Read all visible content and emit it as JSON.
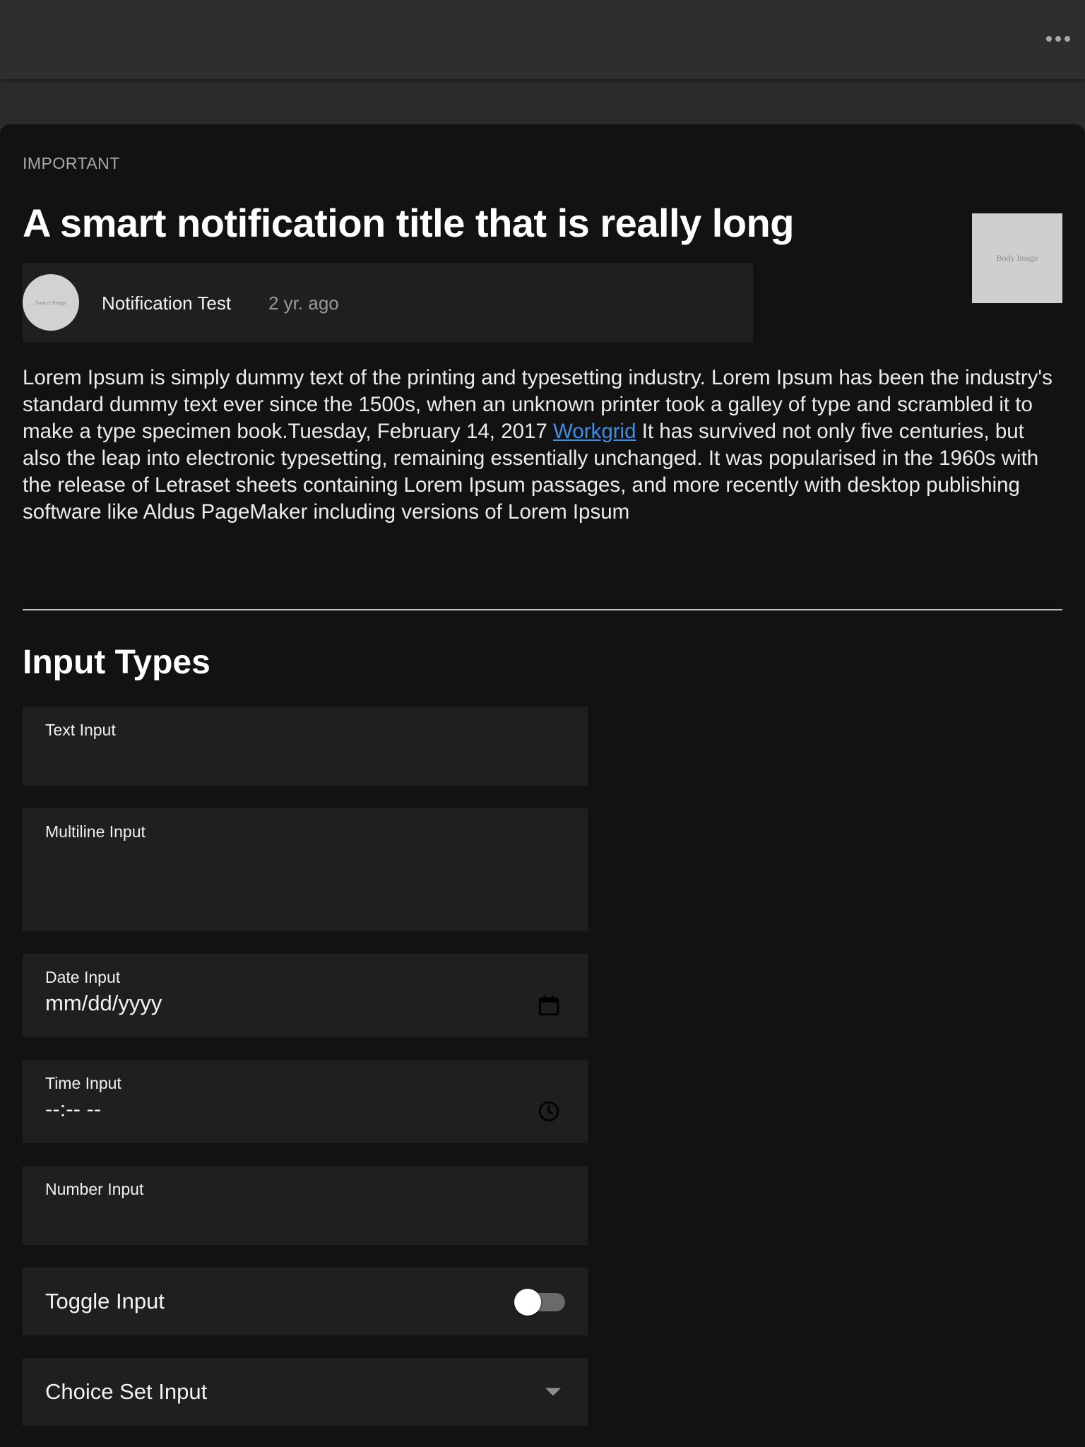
{
  "header": {
    "more_icon": "more-horizontal-icon"
  },
  "notification": {
    "category": "IMPORTANT",
    "title": "A smart notification title that is really long",
    "body_image_label": "Body Image",
    "sender": {
      "avatar_label": "Source Image",
      "name": "Notification Test",
      "time": "2 yr. ago"
    },
    "body": {
      "text_before_link": "Lorem Ipsum is simply dummy text of the printing and typesetting industry. Lorem Ipsum has been the industry's standard dummy text ever since the 1500s, when an unknown printer took a galley of type and scrambled it to make a type specimen book.Tuesday, February 14, 2017 ",
      "link_text": "Workgrid",
      "text_after_link": " It has survived not only five centuries, but also the leap into electronic typesetting, remaining essentially unchanged. It was popularised in the 1960s with the release of Letraset sheets containing Lorem Ipsum passages, and more recently with desktop publishing software like Aldus PageMaker including versions of Lorem Ipsum"
    }
  },
  "form": {
    "heading": "Input Types",
    "text_input": {
      "label": "Text Input",
      "value": ""
    },
    "multiline_input": {
      "label": "Multiline Input",
      "value": ""
    },
    "date_input": {
      "label": "Date Input",
      "placeholder": "mm/dd/yyyy",
      "icon": "calendar-icon"
    },
    "time_input": {
      "label": "Time Input",
      "placeholder": "--:-- --",
      "icon": "clock-icon"
    },
    "number_input": {
      "label": "Number Input",
      "value": ""
    },
    "toggle_input": {
      "label": "Toggle Input",
      "checked": false
    },
    "choice_set_input": {
      "label": "Choice Set Input",
      "icon": "chevron-down-icon"
    }
  },
  "colors": {
    "card_background": "#121212",
    "field_background": "#1f1f1f",
    "link": "#3d8fe8",
    "muted_text": "#9a9a9a"
  }
}
